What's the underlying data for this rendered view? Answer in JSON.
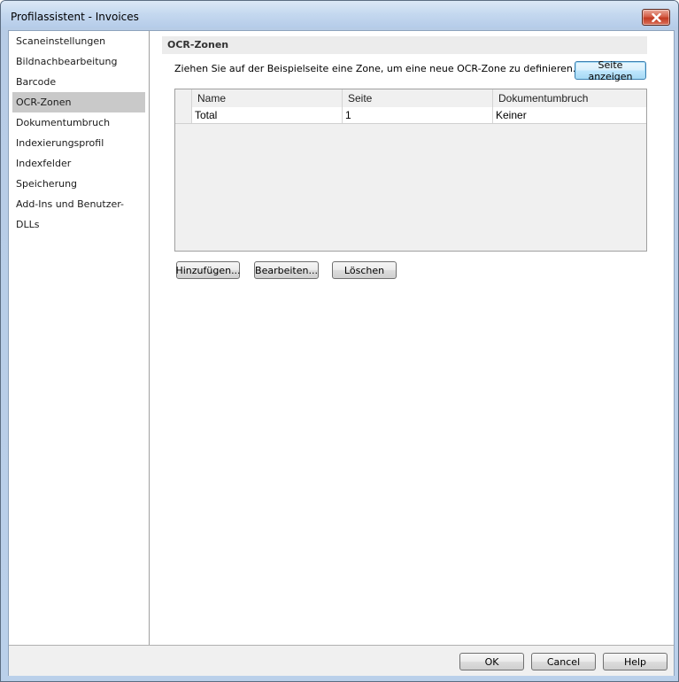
{
  "window": {
    "title": "Profilassistent - Invoices"
  },
  "sidebar": {
    "items": [
      {
        "label": "Scaneinstellungen"
      },
      {
        "label": "Bildnachbearbeitung"
      },
      {
        "label": "Barcode"
      },
      {
        "label": "OCR-Zonen",
        "selected": true
      },
      {
        "label": "Dokumentumbruch"
      },
      {
        "label": "Indexierungsprofil"
      },
      {
        "label": "Indexfelder"
      },
      {
        "label": "Speicherung"
      },
      {
        "label": "Add-Ins und Benutzer-DLLs"
      }
    ]
  },
  "main": {
    "section_title": "OCR-Zonen",
    "instruction": "Ziehen Sie auf der Beispielseite eine Zone, um eine neue OCR-Zone zu definieren.",
    "show_page_button": "Seite anzeigen",
    "table": {
      "columns": [
        "Name",
        "Seite",
        "Dokumentumbruch"
      ],
      "rows": [
        [
          "Total",
          "1",
          "Keiner"
        ]
      ]
    },
    "add_button": "Hinzufügen...",
    "edit_button": "Bearbeiten...",
    "delete_button": "Löschen"
  },
  "footer": {
    "ok_button": "OK",
    "cancel_button": "Cancel",
    "help_button": "Help"
  },
  "colors": {
    "selected_nav": "#c9c9c9",
    "close_button": "#c33a22"
  },
  "icons": {
    "close": "close-icon"
  }
}
